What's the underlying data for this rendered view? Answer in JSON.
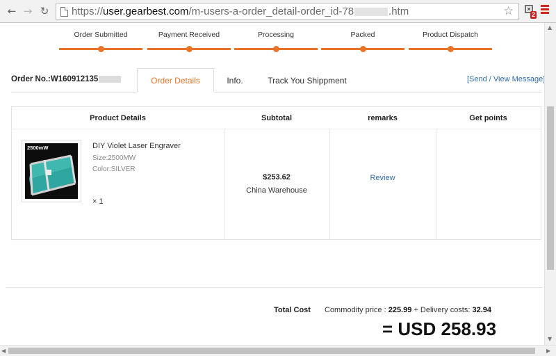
{
  "browser": {
    "url_scheme": "https://",
    "url_host": "user.gearbest.com",
    "url_path": "/m-users-a-order_detail-order_id-78",
    "url_suffix": ".htm",
    "ext_badge": "2",
    "back_icon": "back-arrow",
    "forward_icon": "forward-arrow",
    "reload_icon": "reload",
    "star_icon": "star-outline",
    "menu_icon": "hamburger-menu"
  },
  "steps": [
    "Order Submitted",
    "Payment Received",
    "Processing",
    "Packed",
    "Product Dispatch"
  ],
  "order": {
    "number_label": "Order No.:W160912135"
  },
  "tabs": {
    "details": "Order Details",
    "info": "Info.",
    "track": "Track You Shippment"
  },
  "message_link": "[Send / View Message]",
  "table": {
    "headers": [
      "Product Details",
      "Subtotal",
      "remarks",
      "Get points"
    ],
    "product": {
      "image_label": "2500mW",
      "name": "DIY Violet Laser Engraver",
      "size": "Size:2500MW",
      "color": "Color:SILVER",
      "qty": "× 1",
      "price": "$253.62",
      "warehouse": "China Warehouse",
      "review": "Review"
    }
  },
  "totals": {
    "label": "Total Cost",
    "commodity_label": "Commodity price :",
    "commodity_value": "225.99",
    "delivery_label": "+ Delivery costs:",
    "delivery_value": "32.94",
    "grand": "= USD 258.93"
  },
  "colors": {
    "accent": "#e8742a",
    "link": "#2f6aa7"
  }
}
